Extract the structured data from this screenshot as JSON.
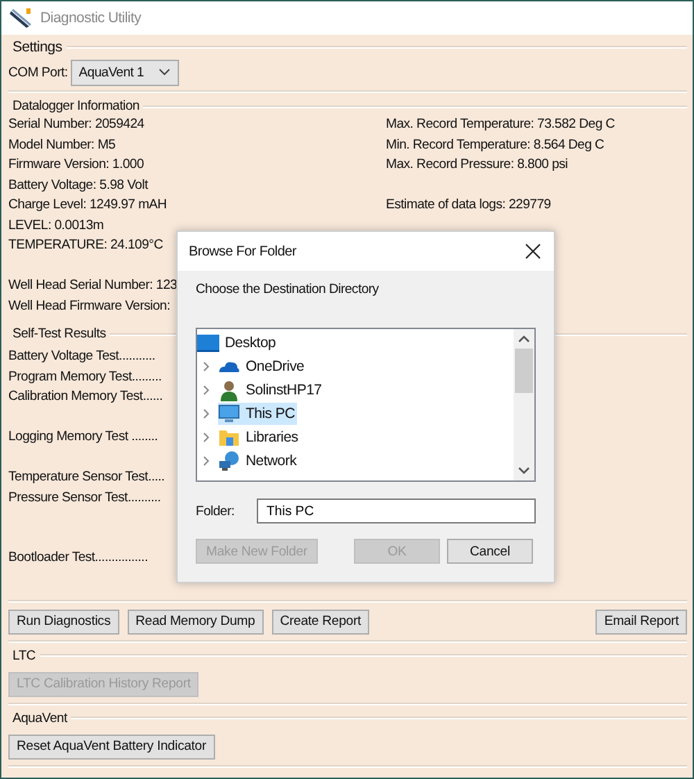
{
  "window": {
    "title": "Diagnostic Utility"
  },
  "settings": {
    "title": "Settings",
    "com_port_label": "COM Port:",
    "com_port_value": "AquaVent 1"
  },
  "datalogger": {
    "title": "Datalogger Information",
    "left_groups": [
      [
        "Serial Number: 2059424",
        "Model Number: M5",
        "Firmware Version: 1.000",
        "Battery Voltage: 5.98 Volt",
        "Charge Level: 1249.97 mAH",
        "LEVEL: 0.0013m",
        "TEMPERATURE: 24.109°C"
      ],
      [
        "Well Head Serial Number: 123",
        "Well Head Firmware Version:"
      ]
    ],
    "right_groups": [
      [
        "Max. Record Temperature: 73.582 Deg C",
        "Min. Record Temperature: 8.564 Deg C",
        "Max. Record Pressure: 8.800 psi"
      ],
      [
        "Estimate of data logs: 229779"
      ]
    ]
  },
  "self_test": {
    "title": "Self-Test Results",
    "groups": [
      [
        "Battery Voltage Test...........",
        "Program Memory Test.........",
        "Calibration Memory Test......"
      ],
      [
        "Logging Memory Test ........"
      ],
      [
        "Temperature Sensor Test.....",
        "Pressure Sensor Test.........."
      ],
      [
        "Bootloader Test................"
      ]
    ]
  },
  "actions": {
    "buttons": [
      "Run Diagnostics",
      "Read Memory Dump",
      "Create Report"
    ],
    "email_button": "Email Report"
  },
  "ltc": {
    "title": "LTC",
    "button": {
      "label": "LTC Calibration History Report",
      "disabled": true
    }
  },
  "aquavent": {
    "title": "AquaVent",
    "button": {
      "label": "Reset AquaVent Battery Indicator",
      "disabled": false
    }
  },
  "dialog": {
    "title": "Browse For Folder",
    "prompt": "Choose the Destination Directory",
    "tree": [
      {
        "label": "Desktop",
        "kind": "desktop",
        "expandable": false,
        "selected": false
      },
      {
        "label": "OneDrive",
        "kind": "cloud",
        "expandable": true,
        "selected": false
      },
      {
        "label": "SolinstHP17",
        "kind": "user",
        "expandable": true,
        "selected": false
      },
      {
        "label": "This PC",
        "kind": "computer",
        "expandable": true,
        "selected": true
      },
      {
        "label": "Libraries",
        "kind": "folder",
        "expandable": true,
        "selected": false
      },
      {
        "label": "Network",
        "kind": "network",
        "expandable": true,
        "selected": false
      }
    ],
    "folder_label": "Folder:",
    "folder_value": "This PC",
    "buttons": [
      {
        "label": "Make New Folder",
        "disabled": true
      },
      {
        "label": "OK",
        "disabled": true
      },
      {
        "label": "Cancel",
        "disabled": false
      }
    ]
  }
}
